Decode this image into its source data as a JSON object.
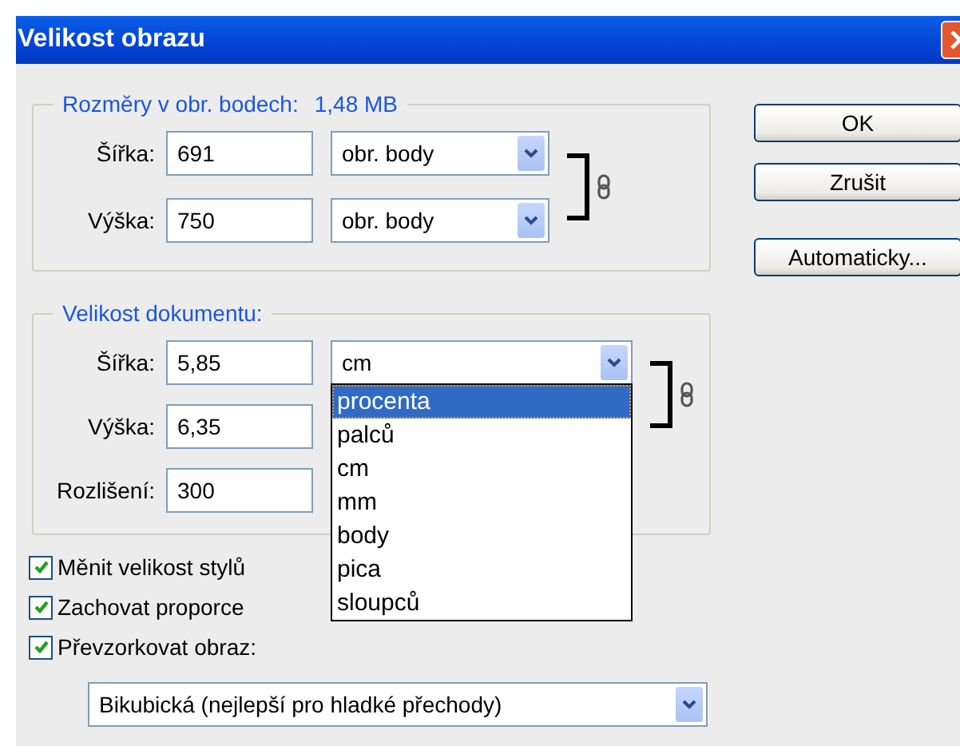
{
  "window": {
    "title": "Velikost obrazu"
  },
  "pixel_group": {
    "legend": "Rozměry v obr. bodech:",
    "size": "1,48 MB",
    "rows": [
      {
        "label": "Šířka:",
        "value": "691",
        "unit": "obr. body"
      },
      {
        "label": "Výška:",
        "value": "750",
        "unit": "obr. body"
      }
    ]
  },
  "document_group": {
    "legend": "Velikost dokumentu:",
    "rows": [
      {
        "label": "Šířka:",
        "value": "5,85",
        "unit": "cm"
      },
      {
        "label": "Výška:",
        "value": "6,35"
      },
      {
        "label": "Rozlišení:",
        "value": "300"
      }
    ],
    "unit_options": [
      {
        "label": "procenta",
        "selected": true
      },
      {
        "label": "palců",
        "selected": false
      },
      {
        "label": "cm",
        "selected": false
      },
      {
        "label": "mm",
        "selected": false
      },
      {
        "label": "body",
        "selected": false
      },
      {
        "label": "pica",
        "selected": false
      },
      {
        "label": "sloupců",
        "selected": false
      }
    ]
  },
  "checkboxes": [
    {
      "label": "Měnit velikost stylů",
      "checked": true
    },
    {
      "label": "Zachovat proporce",
      "checked": true
    },
    {
      "label": "Převzorkovat obraz:",
      "checked": true
    }
  ],
  "resample_method": "Bikubická (nejlepší pro hladké přechody)",
  "buttons": [
    "OK",
    "Zrušit",
    "Automaticky..."
  ]
}
